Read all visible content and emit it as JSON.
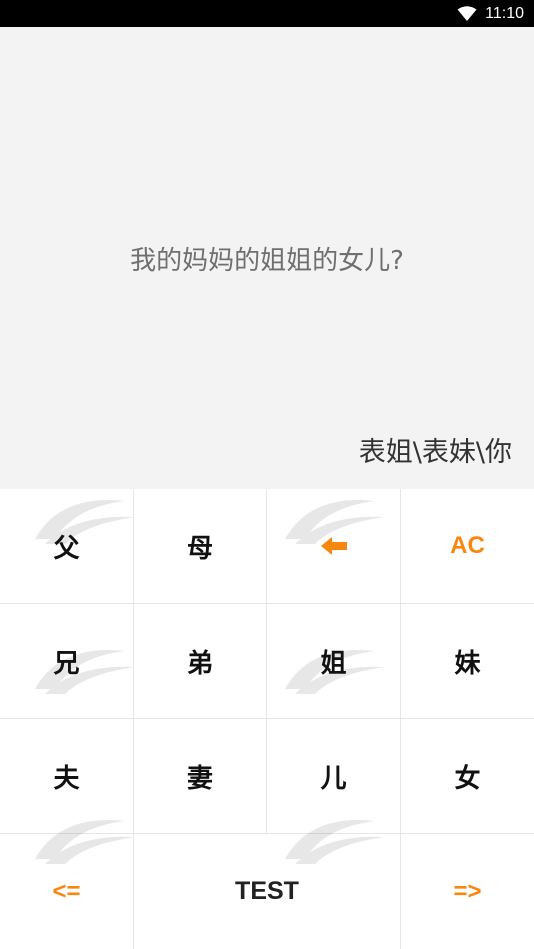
{
  "status_bar": {
    "time": "11:10",
    "icons": [
      "wifi-icon"
    ]
  },
  "display": {
    "question": "我的妈妈的姐姐的女儿?",
    "answer": "表姐\\表妹\\你"
  },
  "keypad": {
    "row1": {
      "father": "父",
      "mother": "母",
      "backspace_icon": "left-arrow-icon",
      "clear": "AC"
    },
    "row2": {
      "elder_brother": "兄",
      "younger_brother": "弟",
      "elder_sister": "姐",
      "younger_sister": "妹"
    },
    "row3": {
      "husband": "夫",
      "wife": "妻",
      "son": "儿",
      "daughter": "女"
    },
    "row4": {
      "prev": "<=",
      "test": "TEST",
      "next": "=>"
    }
  },
  "colors": {
    "accent": "#f7870e",
    "display_bg": "#f3f3f3",
    "grid_line": "#e6e6e6"
  }
}
